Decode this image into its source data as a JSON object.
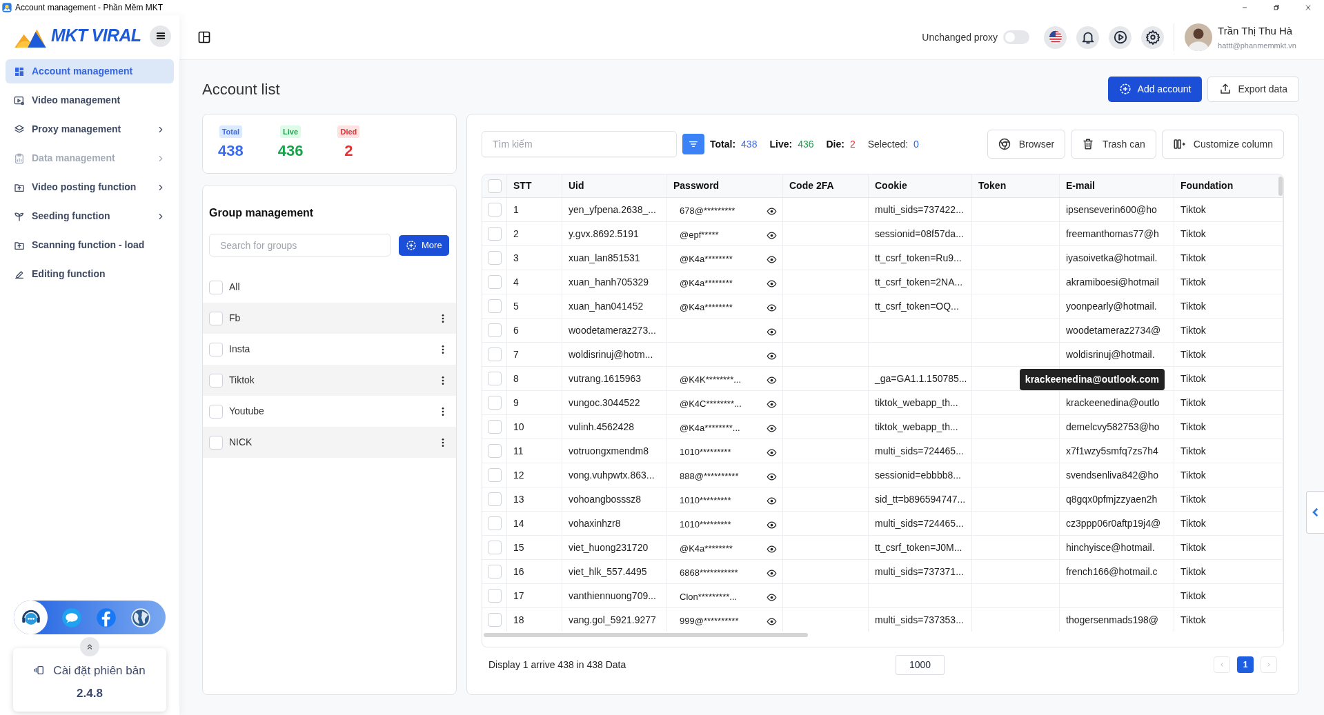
{
  "window": {
    "title": "Account management - Phần Mềm MKT"
  },
  "sidebar": {
    "logo": "MKT VIRAL",
    "items": [
      {
        "label": "Account management",
        "selected": true,
        "disabled": false,
        "has_submenu": false
      },
      {
        "label": "Video management",
        "selected": false,
        "disabled": false,
        "has_submenu": false
      },
      {
        "label": "Proxy management",
        "selected": false,
        "disabled": false,
        "has_submenu": true
      },
      {
        "label": "Data management",
        "selected": false,
        "disabled": true,
        "has_submenu": true
      },
      {
        "label": "Video posting function",
        "selected": false,
        "disabled": false,
        "has_submenu": true
      },
      {
        "label": "Seeding function",
        "selected": false,
        "disabled": false,
        "has_submenu": true
      },
      {
        "label": "Scanning function - load",
        "selected": false,
        "disabled": false,
        "has_submenu": false
      },
      {
        "label": "Editing function",
        "selected": false,
        "disabled": false,
        "has_submenu": false
      }
    ],
    "version": {
      "label": "Cài đặt phiên bản",
      "number": "2.4.8"
    }
  },
  "header": {
    "proxy": {
      "label": "Unchanged proxy",
      "on": false
    },
    "user": {
      "name": "Trần Thị Thu Hà",
      "email": "hattt@phanmemmkt.vn"
    }
  },
  "page": {
    "title": "Account list",
    "actions": [
      {
        "label": "Add account",
        "kind": "primary"
      },
      {
        "label": "Export data",
        "kind": "outline"
      }
    ]
  },
  "stats": [
    {
      "label": "Total",
      "value": "438",
      "color": "#3b6cf0"
    },
    {
      "label": "Live",
      "value": "436",
      "color": "#16a34a"
    },
    {
      "label": "Died",
      "value": "2",
      "color": "#ef2b2b"
    }
  ],
  "groups": {
    "title": "Group management",
    "search_placeholder": "Search for groups",
    "more_button": "More",
    "items": [
      {
        "label": "All",
        "checked": false,
        "has_menu": false
      },
      {
        "label": "Fb",
        "checked": false,
        "has_menu": true
      },
      {
        "label": "Insta",
        "checked": false,
        "has_menu": true
      },
      {
        "label": "Tiktok",
        "checked": false,
        "has_menu": true
      },
      {
        "label": "Youtube",
        "checked": false,
        "has_menu": true
      },
      {
        "label": "NICK",
        "checked": false,
        "has_menu": true
      }
    ]
  },
  "toolbar": {
    "search_placeholder": "Tìm kiếm",
    "counts": [
      {
        "label": "Total:",
        "value": "438",
        "color": "#3b6cf0"
      },
      {
        "label": "Live:",
        "value": "436",
        "color": "#16a34a"
      },
      {
        "label": "Die:",
        "value": "2",
        "color": "#ef2b2b"
      },
      {
        "label": "Selected:",
        "value": "0",
        "color": "#2563eb"
      }
    ],
    "buttons": [
      {
        "label": "Browser"
      },
      {
        "label": "Trash can"
      },
      {
        "label": "Customize column"
      }
    ]
  },
  "table": {
    "all_checked": false,
    "columns": [
      "STT",
      "Uid",
      "Password",
      "Code 2FA",
      "Cookie",
      "Token",
      "E-mail",
      "Foundation"
    ],
    "rows": [
      {
        "checked": false,
        "stt": "1",
        "uid": "yen_yfpena.2638_...",
        "password": "678@*********",
        "cookie": "multi_sids=737422...",
        "email": "ipsenseverin600@ho",
        "foundation": "Tiktok"
      },
      {
        "checked": false,
        "stt": "2",
        "uid": "y.gvx.8692.5191",
        "password": "@epf*****",
        "cookie": "sessionid=08f57da...",
        "email": "freemanthomas77@h",
        "foundation": "Tiktok"
      },
      {
        "checked": false,
        "stt": "3",
        "uid": "xuan_lan851531",
        "password": "@K4a********",
        "cookie": "tt_csrf_token=Ru9...",
        "email": "iyasoivetka@hotmail.",
        "foundation": "Tiktok"
      },
      {
        "checked": false,
        "stt": "4",
        "uid": "xuan_hanh705329",
        "password": "@K4a********",
        "cookie": "tt_csrf_token=2NA...",
        "email": "akramiboesi@hotmail",
        "foundation": "Tiktok"
      },
      {
        "checked": false,
        "stt": "5",
        "uid": "xuan_han041452",
        "password": "@K4a********",
        "cookie": "tt_csrf_token=OQ...",
        "email": "yoonpearly@hotmail.",
        "foundation": "Tiktok"
      },
      {
        "checked": false,
        "stt": "6",
        "uid": "woodetameraz273...",
        "email": "woodetameraz2734@",
        "foundation": "Tiktok"
      },
      {
        "checked": false,
        "stt": "7",
        "uid": "woldisrinuj@hotm...",
        "email": "woldisrinuj@hotmail.",
        "foundation": "Tiktok"
      },
      {
        "checked": false,
        "stt": "8",
        "uid": "vutrang.1615963",
        "password": "@K4K********...",
        "cookie": "_ga=GA1.1.150785...",
        "foundation": "Tiktok",
        "tooltip": "krackeenedina@outlook.com"
      },
      {
        "checked": false,
        "stt": "9",
        "uid": "vungoc.3044522",
        "password": "@K4C********...",
        "cookie": "tiktok_webapp_th...",
        "email": "krackeenedina@outlo",
        "foundation": "Tiktok"
      },
      {
        "checked": false,
        "stt": "10",
        "uid": "vulinh.4562428",
        "password": "@K4a********...",
        "cookie": "tiktok_webapp_th...",
        "email": "demelcvy582753@ho",
        "foundation": "Tiktok"
      },
      {
        "checked": false,
        "stt": "11",
        "uid": "votruongxmendm8",
        "password": "1010*********",
        "cookie": "multi_sids=724465...",
        "email": "x7f1wzy5smfq7zs7h4",
        "foundation": "Tiktok"
      },
      {
        "checked": false,
        "stt": "12",
        "uid": "vong.vuhpwtx.863...",
        "password": "888@**********",
        "cookie": "sessionid=ebbbb8...",
        "email": "svendsenliva842@ho",
        "foundation": "Tiktok"
      },
      {
        "checked": false,
        "stt": "13",
        "uid": "vohoangbosssz8",
        "password": "1010*********",
        "cookie": "sid_tt=b896594747...",
        "email": "q8gqx0pfmjzzyaen2h",
        "foundation": "Tiktok"
      },
      {
        "checked": false,
        "stt": "14",
        "uid": "vohaxinhzr8",
        "password": "1010*********",
        "cookie": "multi_sids=724465...",
        "email": "cz3ppp06r0aftp19j4@",
        "foundation": "Tiktok"
      },
      {
        "checked": false,
        "stt": "15",
        "uid": "viet_huong231720",
        "password": "@K4a********",
        "cookie": "tt_csrf_token=J0M...",
        "email": "hinchyisce@hotmail.",
        "foundation": "Tiktok"
      },
      {
        "checked": false,
        "stt": "16",
        "uid": "viet_hlk_557.4495",
        "password": "6868***********",
        "cookie": "multi_sids=737371...",
        "email": "french166@hotmail.c",
        "foundation": "Tiktok"
      },
      {
        "checked": false,
        "stt": "17",
        "uid": "vanthiennuong709...",
        "password": "Clon*********...",
        "foundation": "Tiktok"
      },
      {
        "checked": false,
        "stt": "18",
        "uid": "vang.gol_5921.9277",
        "password": "999@**********",
        "cookie": "multi_sids=737353...",
        "email": "thogersenmads198@",
        "foundation": "Tiktok"
      }
    ]
  },
  "footer": {
    "summary": "Display 1 arrive 438 in 438 Data",
    "page_size": "1000",
    "pages": [
      {
        "label": "1",
        "selected": true
      }
    ]
  }
}
